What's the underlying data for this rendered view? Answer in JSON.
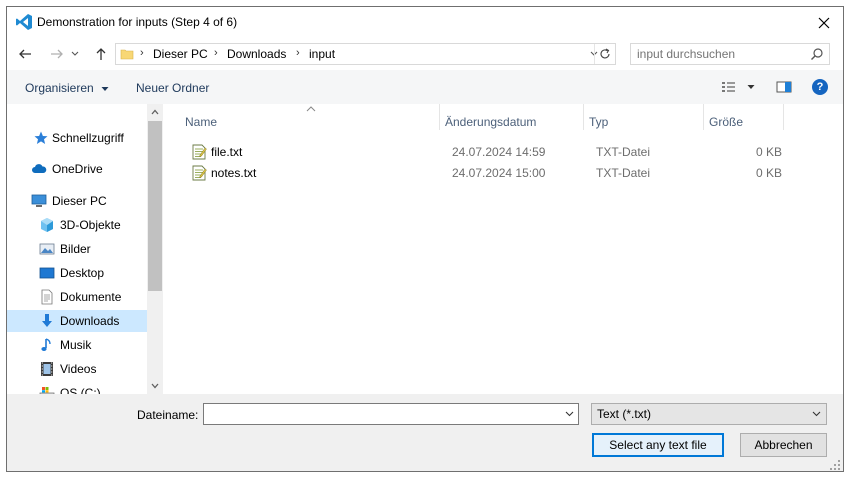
{
  "window": {
    "title": "Demonstration for inputs (Step 4 of 6)",
    "app_icon": "vscode-icon",
    "close_icon": "close-icon"
  },
  "nav": {
    "back_icon": "back-arrow-icon",
    "forward_icon": "forward-arrow-icon",
    "up_icon": "up-arrow-icon",
    "breadcrumbs": [
      "Dieser PC",
      "Downloads",
      "input"
    ],
    "refresh_icon": "refresh-icon"
  },
  "search": {
    "placeholder": "input durchsuchen",
    "icon": "search-icon"
  },
  "toolbar": {
    "organize_label": "Organisieren",
    "new_folder_label": "Neuer Ordner",
    "help_label": "?"
  },
  "sidebar": {
    "items": [
      {
        "label": "Schnellzugriff",
        "icon": "star-icon"
      },
      {
        "label": "OneDrive",
        "icon": "cloud-icon"
      },
      {
        "label": "Dieser PC",
        "icon": "computer-icon"
      },
      {
        "label": "3D-Objekte",
        "icon": "cube-icon"
      },
      {
        "label": "Bilder",
        "icon": "pictures-icon"
      },
      {
        "label": "Desktop",
        "icon": "desktop-icon"
      },
      {
        "label": "Dokumente",
        "icon": "document-icon"
      },
      {
        "label": "Downloads",
        "icon": "download-icon",
        "selected": true
      },
      {
        "label": "Musik",
        "icon": "music-icon"
      },
      {
        "label": "Videos",
        "icon": "video-icon"
      },
      {
        "label": "OS (C:)",
        "icon": "drive-icon"
      }
    ]
  },
  "files": {
    "columns": [
      "Name",
      "Änderungsdatum",
      "Typ",
      "Größe"
    ],
    "rows": [
      {
        "name": "file.txt",
        "modified": "24.07.2024 14:59",
        "type": "TXT-Datei",
        "size": "0 KB"
      },
      {
        "name": "notes.txt",
        "modified": "24.07.2024 15:00",
        "type": "TXT-Datei",
        "size": "0 KB"
      }
    ]
  },
  "footer": {
    "filename_label": "Dateiname:",
    "filename_value": "",
    "filetype_value": "Text (*.txt)",
    "ok_label": "Select any text file",
    "cancel_label": "Abbrechen"
  },
  "colors": {
    "accent": "#0078d7",
    "selected_bg": "#cce8ff",
    "folder": "#f8d775"
  }
}
